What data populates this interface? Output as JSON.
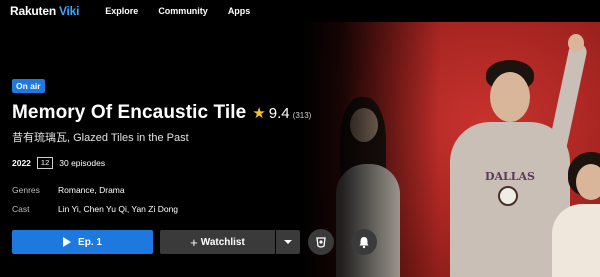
{
  "nav": {
    "logo_brand": "Rakuten",
    "logo_product": "Viki",
    "links": [
      "Explore",
      "Community",
      "Apps"
    ]
  },
  "show": {
    "badge": "On air",
    "title": "Memory Of Encaustic Tile",
    "rating": "9.4",
    "rating_count": "(313)",
    "alt_title": "昔有琉璃瓦, Glazed Tiles in the Past",
    "year": "2022",
    "age_rating": "12",
    "episodes": "30 episodes",
    "genres_label": "Genres",
    "genres": "Romance, Drama",
    "cast_label": "Cast",
    "cast": "Lin Yi, Chen Yu Qi, Yan Zi Dong"
  },
  "actions": {
    "play_label": "Ep. 1",
    "watchlist_label": "Watchlist"
  },
  "colors": {
    "accent": "#1d78e0",
    "star": "#f5c518",
    "hero_bg": "#b72a26"
  },
  "icons": [
    "play-icon",
    "plus-icon",
    "chevron-down-icon",
    "viki-pass-icon",
    "bell-icon"
  ]
}
